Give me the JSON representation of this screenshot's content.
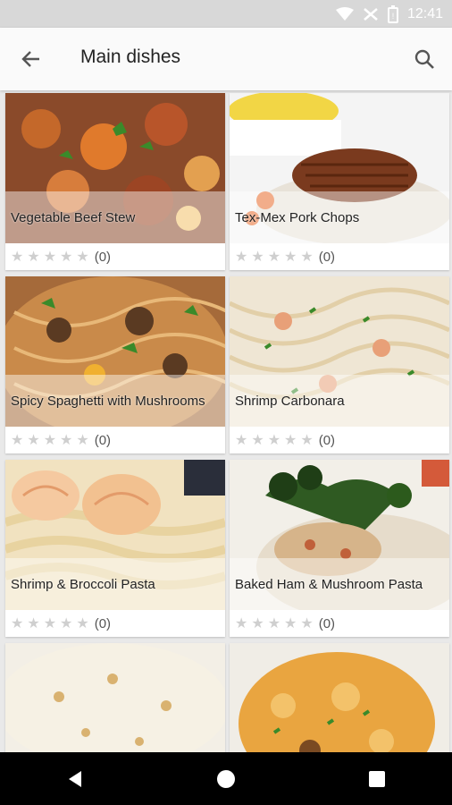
{
  "status_bar": {
    "time": "12:41",
    "icons": [
      "wifi-icon",
      "no-signal-icon",
      "battery-icon"
    ]
  },
  "app_bar": {
    "title": "Main dishes"
  },
  "recipes": [
    {
      "name": "Vegetable Beef Stew",
      "rating_count": "(0)",
      "stars": 0
    },
    {
      "name": "Tex-Mex Pork Chops",
      "rating_count": "(0)",
      "stars": 0
    },
    {
      "name": "Spicy Spaghetti with Mushrooms",
      "rating_count": "(0)",
      "stars": 0
    },
    {
      "name": "Shrimp Carbonara",
      "rating_count": "(0)",
      "stars": 0
    },
    {
      "name": "Shrimp & Broccoli Pasta",
      "rating_count": "(0)",
      "stars": 0
    },
    {
      "name": "Baked Ham & Mushroom Pasta",
      "rating_count": "(0)",
      "stars": 0
    },
    {
      "name": "",
      "rating_count": "",
      "stars": 0
    },
    {
      "name": "",
      "rating_count": "",
      "stars": 0
    }
  ],
  "colors": {
    "star_empty": "#cfcfcf",
    "app_bar_bg": "#fafafa",
    "status_bar_bg": "#d8d8d8"
  }
}
